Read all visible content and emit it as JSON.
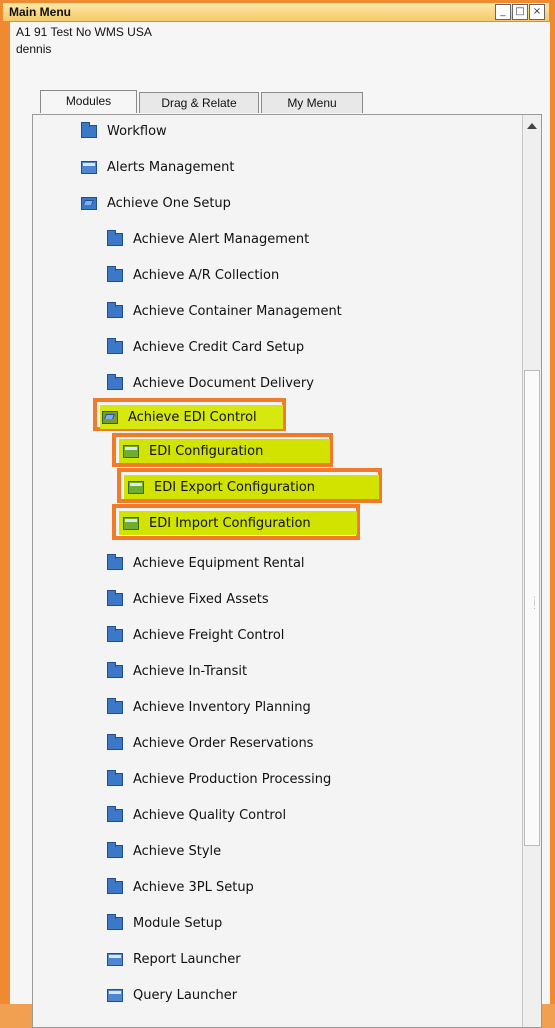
{
  "window": {
    "title": "Main Menu",
    "company": "A1 91 Test No WMS USA",
    "user": "dennis"
  },
  "tabs": [
    {
      "label": "Modules"
    },
    {
      "label": "Drag & Relate"
    },
    {
      "label": "My Menu"
    }
  ],
  "menu_items": [
    {
      "label": "Workflow"
    },
    {
      "label": "Alerts Management"
    },
    {
      "label": "Achieve One Setup"
    },
    {
      "label": "Achieve Alert Management"
    },
    {
      "label": "Achieve A/R Collection"
    },
    {
      "label": "Achieve Container Management"
    },
    {
      "label": "Achieve Credit Card Setup"
    },
    {
      "label": "Achieve Document Delivery"
    },
    {
      "label": "Achieve EDI Control"
    },
    {
      "label": "EDI Configuration"
    },
    {
      "label": "EDI Export Configuration"
    },
    {
      "label": "EDI Import Configuration"
    },
    {
      "label": "Achieve Equipment Rental"
    },
    {
      "label": "Achieve Fixed Assets"
    },
    {
      "label": "Achieve Freight Control"
    },
    {
      "label": "Achieve In-Transit"
    },
    {
      "label": "Achieve Inventory Planning"
    },
    {
      "label": "Achieve Order Reservations"
    },
    {
      "label": "Achieve Production Processing"
    },
    {
      "label": "Achieve Quality Control"
    },
    {
      "label": "Achieve Style"
    },
    {
      "label": "Achieve 3PL Setup"
    },
    {
      "label": "Module Setup"
    },
    {
      "label": "Report Launcher"
    },
    {
      "label": "Query Launcher"
    }
  ],
  "colors": {
    "highlight_border": "#f07c2b",
    "highlight_fill": "#d7e80f"
  }
}
